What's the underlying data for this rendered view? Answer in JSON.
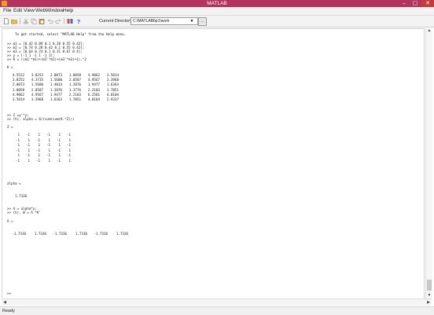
{
  "window": {
    "title": "MATLAB",
    "controls": {
      "minimize": "–",
      "maximize": "▢",
      "close": "✕"
    }
  },
  "menu": [
    "File",
    "Edit",
    "View",
    "Web",
    "Window",
    "Help"
  ],
  "toolbar": {
    "icons": [
      "new-file-icon",
      "open-folder-icon",
      "cut-icon",
      "copy-icon",
      "paste-icon",
      "undo-icon",
      "redo-icon",
      "simulink-icon",
      "help-icon"
    ],
    "current_directory_label": "Current Directory:",
    "current_directory_value": "C:\\MATLAB6p1\\work",
    "browse_label": "..."
  },
  "console": {
    "intro": "To get started, select \"MATLAB Help\" from the Help menu.",
    "commands1": [
      ">> m1 = [0.42 0.89 0.1 0.28 0.55 0.42];",
      ">> m2 = [0.74 0.28 0.42 0.1 0.55 0.42];",
      ">> m3 = [0.64 0.74 0.1 0.31 0.67 0.4];",
      ">> y = [-1 1 -1 1 -1 1];",
      ">> K = ((m1'*m1)+(m2'*m2)+(m3'*m3)+1).^2"
    ],
    "K_label": "K =",
    "K_matrix": [
      [
        "4.5522",
        "3.8252",
        "2.0073",
        "1.8058",
        "4.9062",
        "3.5014"
      ],
      [
        "3.8252",
        "4.3735",
        "1.5680",
        "2.0587",
        "4.9567",
        "3.3968"
      ],
      [
        "2.0073",
        "1.5680",
        "1.4014",
        "1.2076",
        "1.9477",
        "1.6363"
      ],
      [
        "1.8058",
        "2.0587",
        "1.2076",
        "1.3776",
        "2.2103",
        "1.7851"
      ],
      [
        "4.9062",
        "4.9567",
        "1.9477",
        "2.2103",
        "6.2581",
        "4.0104"
      ],
      [
        "3.5014",
        "3.3968",
        "1.6363",
        "1.7851",
        "4.0104",
        "2.9337"
      ]
    ],
    "commands2": [
      ">> Z =y'*y;",
      ">> (h), alpha = 6/(sum(sum(K.*Z)))"
    ],
    "Z_label": "Z =",
    "Z_matrix": [
      [
        "1",
        "-1",
        "1",
        "-1",
        "1",
        "-1"
      ],
      [
        "-1",
        "1",
        "-1",
        "1",
        "-1",
        "1"
      ],
      [
        "1",
        "-1",
        "1",
        "-1",
        "1",
        "-1"
      ],
      [
        "-1",
        "1",
        "-1",
        "1",
        "-1",
        "1"
      ],
      [
        "1",
        "-1",
        "1",
        "-1",
        "1",
        "-1"
      ],
      [
        "-1",
        "1",
        "-1",
        "1",
        "-1",
        "1"
      ]
    ],
    "alpha_label": "alpha =",
    "alpha_value": "1.7336",
    "commands3": [
      ">> A = alpha*y;",
      ">> (h), W = A *K'"
    ],
    "A_label": "A =",
    "A_values": [
      "-1.7336",
      "1.7336",
      "-1.7336",
      "1.7336",
      "-1.7336",
      "1.7336"
    ],
    "prompt": ">>"
  },
  "scrollbars": {
    "up": "▲",
    "down": "▼",
    "left": "◀",
    "right": "▶"
  },
  "status": "Ready"
}
